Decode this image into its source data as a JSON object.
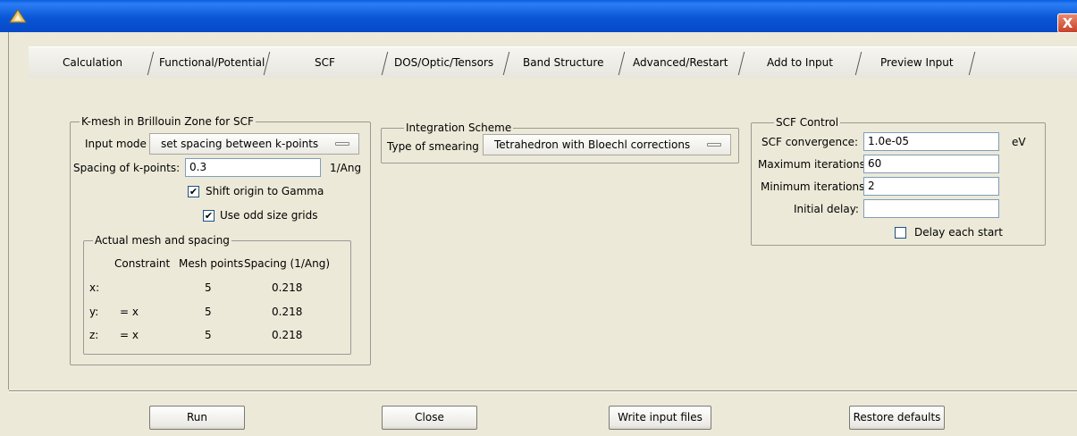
{
  "window": {
    "close_glyph": "X"
  },
  "tabs": [
    {
      "label": "Calculation"
    },
    {
      "label": "Functional/Potential"
    },
    {
      "label": "SCF",
      "selected": true
    },
    {
      "label": "DOS/Optic/Tensors"
    },
    {
      "label": "Band Structure"
    },
    {
      "label": "Advanced/Restart"
    },
    {
      "label": "Add to Input"
    },
    {
      "label": "Preview Input"
    }
  ],
  "kmesh": {
    "title": "K-mesh in Brillouin Zone for SCF",
    "input_mode_label": "Input mode",
    "input_mode_value": "set spacing between k-points",
    "spacing_label": "Spacing of k-points:",
    "spacing_value": "0.3",
    "spacing_unit": "1/Ang",
    "shift_origin_label": "Shift origin to Gamma",
    "shift_origin_checked": true,
    "odd_grids_label": "Use odd size grids",
    "odd_grids_checked": true,
    "actual": {
      "title": "Actual mesh and spacing",
      "headers": [
        "Constraint",
        "Mesh points",
        "Spacing (1/Ang)"
      ],
      "rows": [
        {
          "axis": "x:",
          "constraint": "",
          "points": "5",
          "spacing": "0.218"
        },
        {
          "axis": "y:",
          "constraint": "= x",
          "points": "5",
          "spacing": "0.218"
        },
        {
          "axis": "z:",
          "constraint": "= x",
          "points": "5",
          "spacing": "0.218"
        }
      ]
    }
  },
  "integration": {
    "title": "Integration Scheme",
    "smearing_label": "Type of smearing",
    "smearing_value": "Tetrahedron with Bloechl corrections"
  },
  "scf": {
    "title": "SCF Control",
    "convergence_label": "SCF convergence:",
    "convergence_value": "1.0e-05",
    "convergence_unit": "eV",
    "max_iter_label": "Maximum iterations:",
    "max_iter_value": "60",
    "min_iter_label": "Minimum iterations:",
    "min_iter_value": "2",
    "delay_label": "Initial delay:",
    "delay_value": "",
    "delay_each_label": "Delay each start",
    "delay_each_checked": false
  },
  "buttons": {
    "run": "Run",
    "close": "Close",
    "write": "Write input files",
    "restore": "Restore defaults"
  },
  "colors": {
    "titlebar": "#0a56d6",
    "panel": "#ece9d8",
    "close": "#c8412a"
  }
}
